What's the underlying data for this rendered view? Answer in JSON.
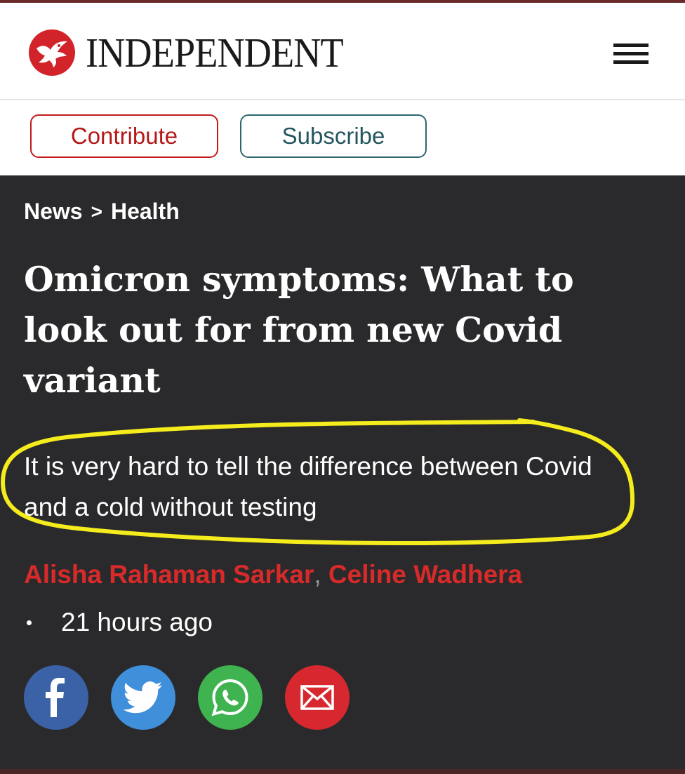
{
  "masthead": {
    "brand": "INDEPENDENT",
    "logo_icon": "independent-eagle-logo",
    "menu_icon": "hamburger-menu-icon"
  },
  "actions": {
    "contribute_label": "Contribute",
    "subscribe_label": "Subscribe"
  },
  "breadcrumb": {
    "section": "News",
    "separator": ">",
    "subsection": "Health"
  },
  "article": {
    "headline": "Omicron symptoms: What to look out for from new Covid variant",
    "standfirst": "It is very hard to tell the difference between Covid and a cold without testing",
    "authors": [
      "Alisha Rahaman Sarkar",
      "Celine Wadhera"
    ],
    "author_separator": ",",
    "published": "21 hours ago"
  },
  "share": {
    "icons": [
      "facebook-icon",
      "twitter-icon",
      "whatsapp-icon",
      "email-icon"
    ]
  },
  "colors": {
    "brand_red": "#c21b1b",
    "subscribe_teal": "#2d6670",
    "article_bg": "#2a2a2c",
    "author_red": "#d92a2a",
    "highlight_yellow": "#f4ec1d",
    "facebook_blue": "#3b62a6",
    "twitter_blue": "#3f8fdb",
    "whatsapp_green": "#3fb34f",
    "email_red": "#d8282f"
  }
}
